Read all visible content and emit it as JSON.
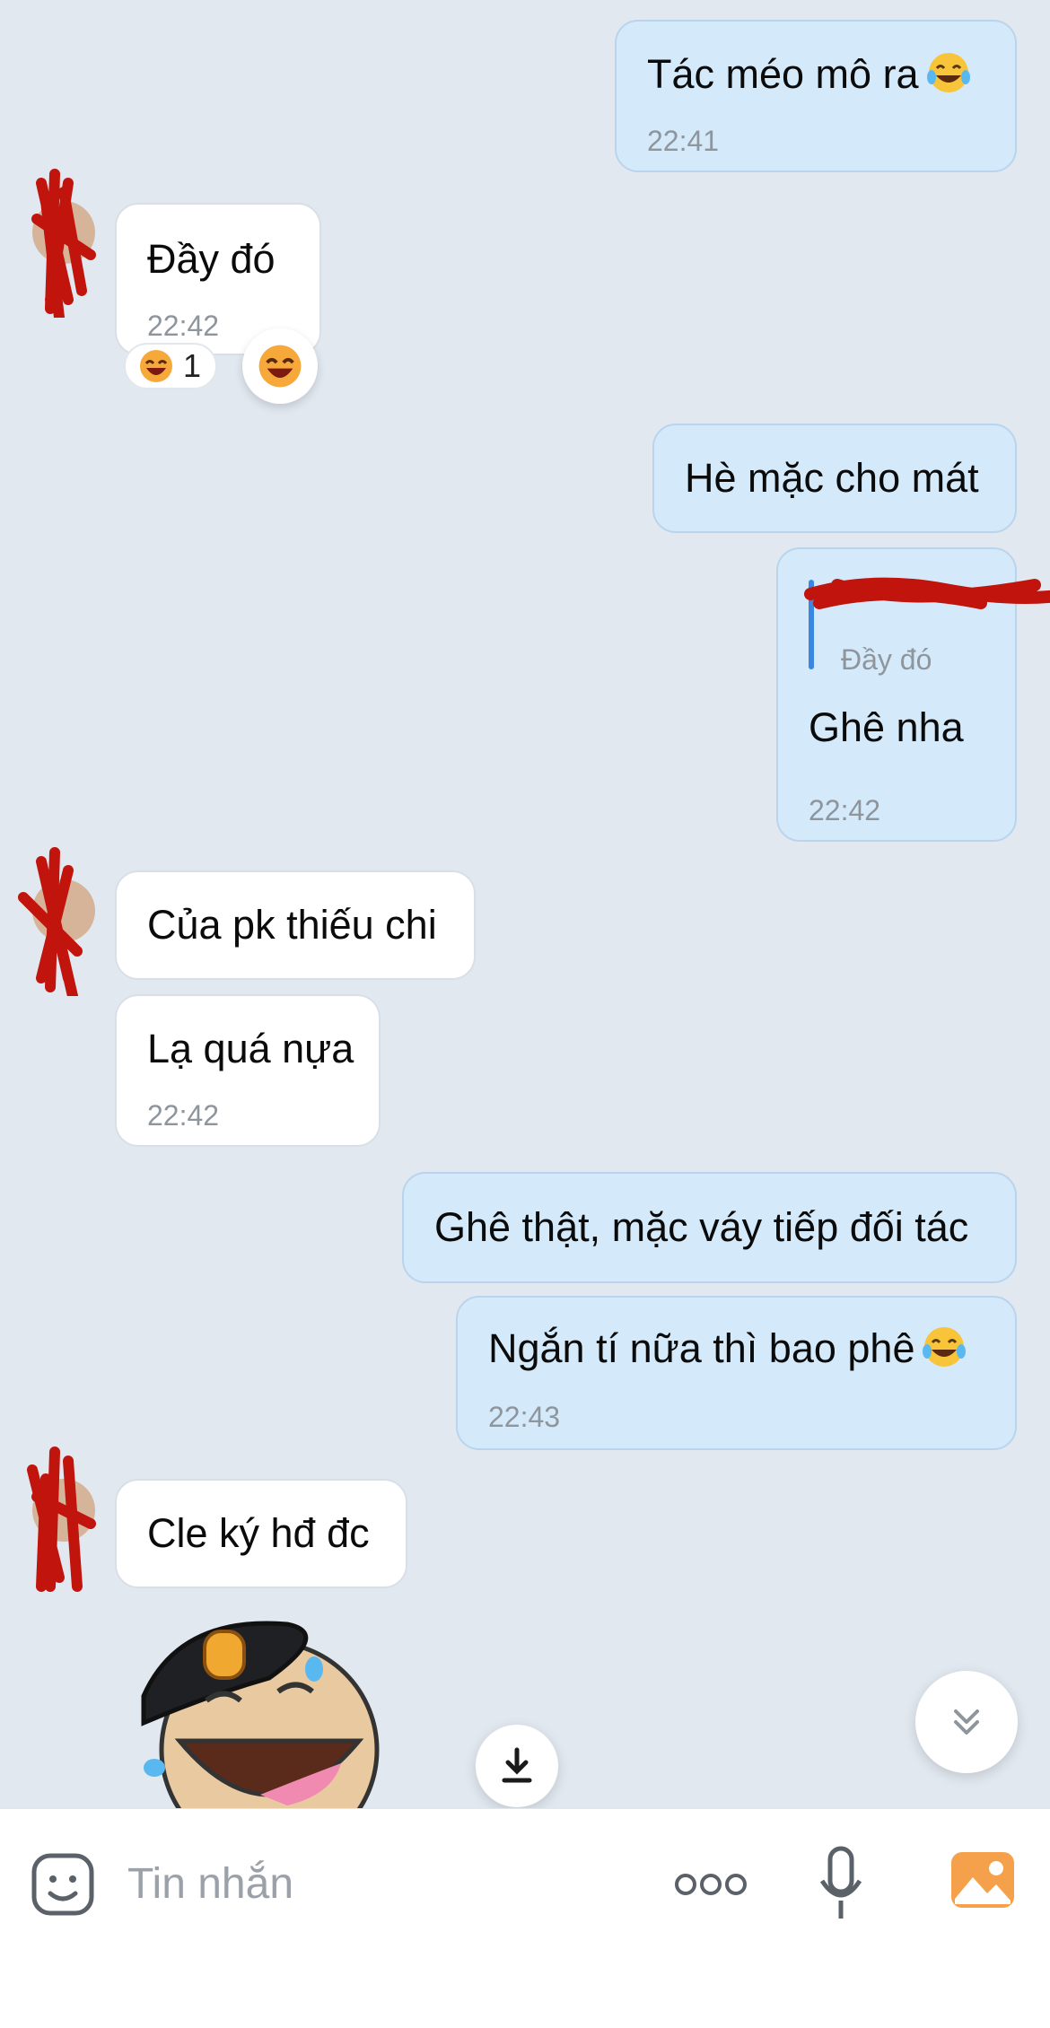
{
  "messages": [
    {
      "id": "m1",
      "dir": "out",
      "text": "Tác méo mô ra",
      "emoji": "😂",
      "time": "22:41"
    },
    {
      "id": "m2",
      "dir": "in",
      "text": "Đầy đó",
      "time": "22:42",
      "reaction": {
        "count": "1",
        "icon": "laughing-face-icon"
      }
    },
    {
      "id": "m3",
      "dir": "out",
      "text": "Hè mặc cho mát"
    },
    {
      "id": "m4",
      "dir": "out",
      "quote": "Đầy đó",
      "text": "Ghê nha",
      "time": "22:42"
    },
    {
      "id": "m5",
      "dir": "in",
      "text": "Của pk thiếu chi"
    },
    {
      "id": "m6",
      "dir": "in",
      "text": "Lạ quá nựa",
      "time": "22:42"
    },
    {
      "id": "m7",
      "dir": "out",
      "text": "Ghê thật, mặc váy tiếp đối tác"
    },
    {
      "id": "m8",
      "dir": "out",
      "text": "Ngắn tí nữa thì bao phê",
      "emoji": "😂",
      "time": "22:43"
    },
    {
      "id": "m9",
      "dir": "in",
      "text": "Cle ký hđ đc"
    }
  ],
  "composer": {
    "placeholder": "Tin nhắn",
    "icons": [
      "sticker-icon",
      "more-icon",
      "microphone-icon",
      "gallery-icon"
    ]
  },
  "floating": {
    "scroll_down_icon": "double-chevron-down-icon",
    "download_icon": "download-icon"
  },
  "colors": {
    "outgoing": "#d4eafb",
    "incoming": "#ffffff",
    "background": "#e2e8f0",
    "accent": "#3a86e0",
    "gallery": "#f5a04a"
  }
}
